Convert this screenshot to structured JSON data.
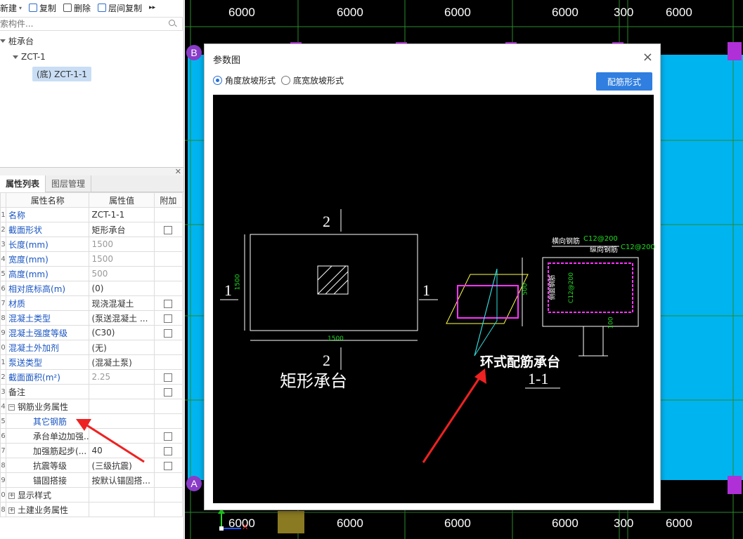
{
  "toolbar": {
    "new_label": "新建",
    "copy_label": "复制",
    "delete_label": "删除",
    "floor_copy_label": "层间复制",
    "more_label": "▸▸"
  },
  "search": {
    "placeholder": "索构件..."
  },
  "tree": {
    "root": "桩承台",
    "child": "ZCT-1",
    "leaf": "(底) ZCT-1-1"
  },
  "tabs": {
    "properties": "属性列表",
    "layers": "图层管理"
  },
  "table": {
    "headers": [
      "属性名称",
      "属性值",
      "附加"
    ],
    "rows": [
      {
        "n": "1",
        "name": "名称",
        "value": "ZCT-1-1"
      },
      {
        "n": "2",
        "name": "截面形状",
        "value": "矩形承台"
      },
      {
        "n": "3",
        "name": "长度(mm)",
        "value": "1500"
      },
      {
        "n": "4",
        "name": "宽度(mm)",
        "value": "1500"
      },
      {
        "n": "5",
        "name": "高度(mm)",
        "value": "500"
      },
      {
        "n": "6",
        "name": "相对底标高(m)",
        "value": "(0)"
      },
      {
        "n": "7",
        "name": "材质",
        "value": "现浇混凝土"
      },
      {
        "n": "8",
        "name": "混凝土类型",
        "value": "(泵送混凝土 ..."
      },
      {
        "n": "9",
        "name": "混凝土强度等级",
        "value": "(C30)"
      },
      {
        "n": "0",
        "name": "混凝土外加剂",
        "value": "(无)"
      },
      {
        "n": "1",
        "name": "泵送类型",
        "value": "(混凝土泵)"
      },
      {
        "n": "2",
        "name": "截面面积(m²)",
        "value": "2.25"
      },
      {
        "n": "3",
        "name": "备注",
        "value": ""
      },
      {
        "n": "4",
        "name": "钢筋业务属性",
        "value": ""
      },
      {
        "n": "5",
        "name": "其它钢筋",
        "value": ""
      },
      {
        "n": "6",
        "name": "承台单边加强...",
        "value": ""
      },
      {
        "n": "7",
        "name": "加强筋起步(...",
        "value": "40"
      },
      {
        "n": "8",
        "name": "抗震等级",
        "value": "(三级抗震)"
      },
      {
        "n": "9",
        "name": "锚固搭接",
        "value": "按默认锚固搭..."
      },
      {
        "n": "0",
        "name": "显示样式",
        "value": ""
      },
      {
        "n": "8",
        "name": "土建业务属性",
        "value": ""
      }
    ]
  },
  "canvas": {
    "top_dims": [
      "6000",
      "6000",
      "6000",
      "6000",
      "300",
      "6000"
    ],
    "bottom_dims": [
      "6000",
      "6000",
      "6000",
      "6000",
      "300",
      "6000"
    ],
    "axis_b": "B",
    "axis_a": "A",
    "ucs_x": "X"
  },
  "dialog": {
    "title": "参数图",
    "close": "×",
    "radio1": "角度放坡形式",
    "radio2": "底宽放坡形式",
    "button": "配筋形式"
  },
  "diagram": {
    "sec_top": "2",
    "sec_bottom": "2",
    "sec_left": "1",
    "sec_right": "1",
    "dim_left": "1500",
    "dim_bottom": "1500",
    "left_title": "矩形承台",
    "right_title": "环式配筋承台",
    "right_section": "1-1",
    "h_rebar": "横向钢筋",
    "h_rebar_spec": "C12@200",
    "v_rebar": "纵向钢筋",
    "v_rebar_spec": "C12@200",
    "side_rebar": "侧面钢筋",
    "side_rebar_spec": "C12@200",
    "dim_500": "500",
    "dim_100": "100"
  },
  "colors": {
    "canvas_bg": "#000000",
    "slab_fill": "#00b4f0",
    "accent_button": "#2f7ee0",
    "arrow": "#ee2222",
    "magenta": "#ff33ff",
    "yellow": "#ffff44",
    "cyan": "#33dddd"
  }
}
